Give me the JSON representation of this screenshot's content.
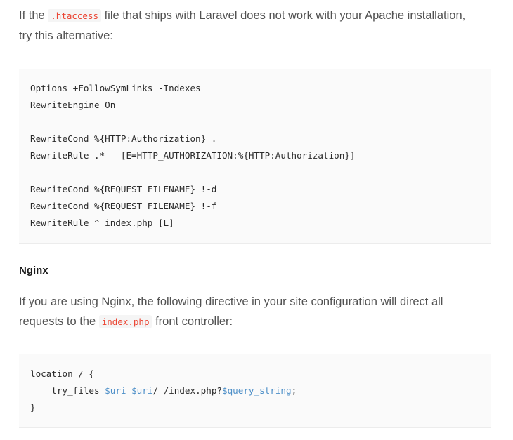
{
  "intro": {
    "text_before": "If the ",
    "code": ".htaccess",
    "text_after_line1": " file that ships with Laravel does not work with your Apache installation,",
    "text_line2": "try this alternative:"
  },
  "apache_block": {
    "lines": [
      "Options +FollowSymLinks -Indexes",
      "RewriteEngine On",
      "",
      "RewriteCond %{HTTP:Authorization} .",
      "RewriteRule .* - [E=HTTP_AUTHORIZATION:%{HTTP:Authorization}]",
      "",
      "RewriteCond %{REQUEST_FILENAME} !-d",
      "RewriteCond %{REQUEST_FILENAME} !-f",
      "RewriteRule ^ index.php [L]"
    ]
  },
  "nginx": {
    "heading": "Nginx",
    "text_line1": "If you are using Nginx, the following directive in your site configuration will direct all",
    "text_before_code": "requests to the ",
    "code": "index.php",
    "text_after_code": " front controller:"
  },
  "nginx_block": {
    "line1": "location / {",
    "line2_prefix": "    try_files ",
    "line2_var1": "$uri",
    "line2_space": " ",
    "line2_var2": "$uri",
    "line2_mid": "/ /index.php?",
    "line2_var3": "$query_string",
    "line2_end": ";",
    "line3": "}"
  }
}
